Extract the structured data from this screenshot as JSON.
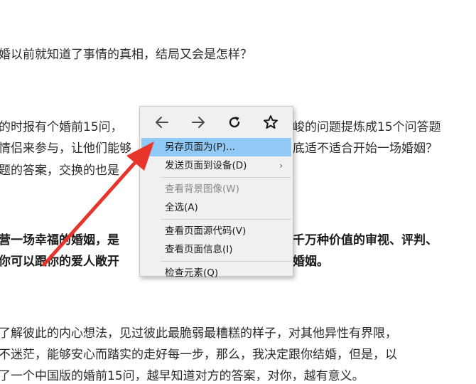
{
  "article": {
    "lines": [
      "婚以前就知道了事情的真相，结局又会是怎样？",
      "的时报有个婚前15问，",
      "峻的问题提炼成15个问答题",
      "情侣来参与，让他们能够",
      "底适不适合开始一场婚姻？",
      "题的答案，交换的也是",
      "营一场幸福的婚姻，是",
      "千万种价值的审视、评判、",
      "你可以跟你的爱人敞开",
      "婚姻。",
      "了解彼此的内心想法，见过彼此最脆弱最糟糕的样子，对其他异性有界限，",
      "不迷茫，能够安心而踏实的走好每一步，那么，我决定跟你结婚，但是，以",
      "了一个中国版的婚前15问，越早知道对方的答案，对你，越有意义。"
    ]
  },
  "context_menu": {
    "nav": {
      "back_icon": "arrow-left-icon",
      "forward_icon": "arrow-right-icon",
      "reload_icon": "reload-icon",
      "bookmark_icon": "star-icon"
    },
    "items": [
      {
        "label": "另存页面为(P)...",
        "state": "highlighted"
      },
      {
        "label": "发送页面到设备(D)",
        "submenu_arrow": "›"
      },
      {
        "label": "查看背景图像(W)",
        "state": "disabled"
      },
      {
        "label": "全选(A)"
      },
      {
        "label": "查看页面源代码(V)"
      },
      {
        "label": "查看页面信息(I)"
      },
      {
        "label": "检查元素(Q)"
      }
    ]
  },
  "colors": {
    "highlight": "#91c9f7",
    "annotation_arrow": "#e8352c",
    "menu_bg": "#f0f0f0"
  }
}
